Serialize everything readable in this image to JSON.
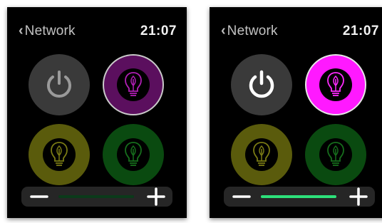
{
  "colors": {
    "screen_bg": "#000000",
    "power_tile_bg": "#3a3a3a",
    "purple_dim": "#5b0f5e",
    "purple_bright": "#ff19ff",
    "yellow_dim": "#5a5b0c",
    "green_dim": "#0a4a10",
    "slider_dim": "#0b3a1a",
    "slider_bright": "#2de07a"
  },
  "screens": [
    {
      "state": "dim",
      "header": {
        "back_label": "Network",
        "time": "21:07"
      },
      "tiles": {
        "power": {
          "icon": "power-icon",
          "state": "off"
        },
        "purple": {
          "icon": "bulb-icon",
          "state": "selected-dim"
        },
        "yellow": {
          "icon": "bulb-icon",
          "state": "dim"
        },
        "green": {
          "icon": "bulb-icon",
          "state": "dim"
        }
      },
      "slider": {
        "minus_icon": "minus-icon",
        "plus_icon": "plus-icon",
        "level": 1.0,
        "lit": false
      }
    },
    {
      "state": "bright",
      "header": {
        "back_label": "Network",
        "time": "21:07"
      },
      "tiles": {
        "power": {
          "icon": "power-icon",
          "state": "on"
        },
        "purple": {
          "icon": "bulb-icon",
          "state": "selected-bright"
        },
        "yellow": {
          "icon": "bulb-icon",
          "state": "dim"
        },
        "green": {
          "icon": "bulb-icon",
          "state": "dim"
        }
      },
      "slider": {
        "minus_icon": "minus-icon",
        "plus_icon": "plus-icon",
        "level": 1.0,
        "lit": true
      }
    }
  ]
}
